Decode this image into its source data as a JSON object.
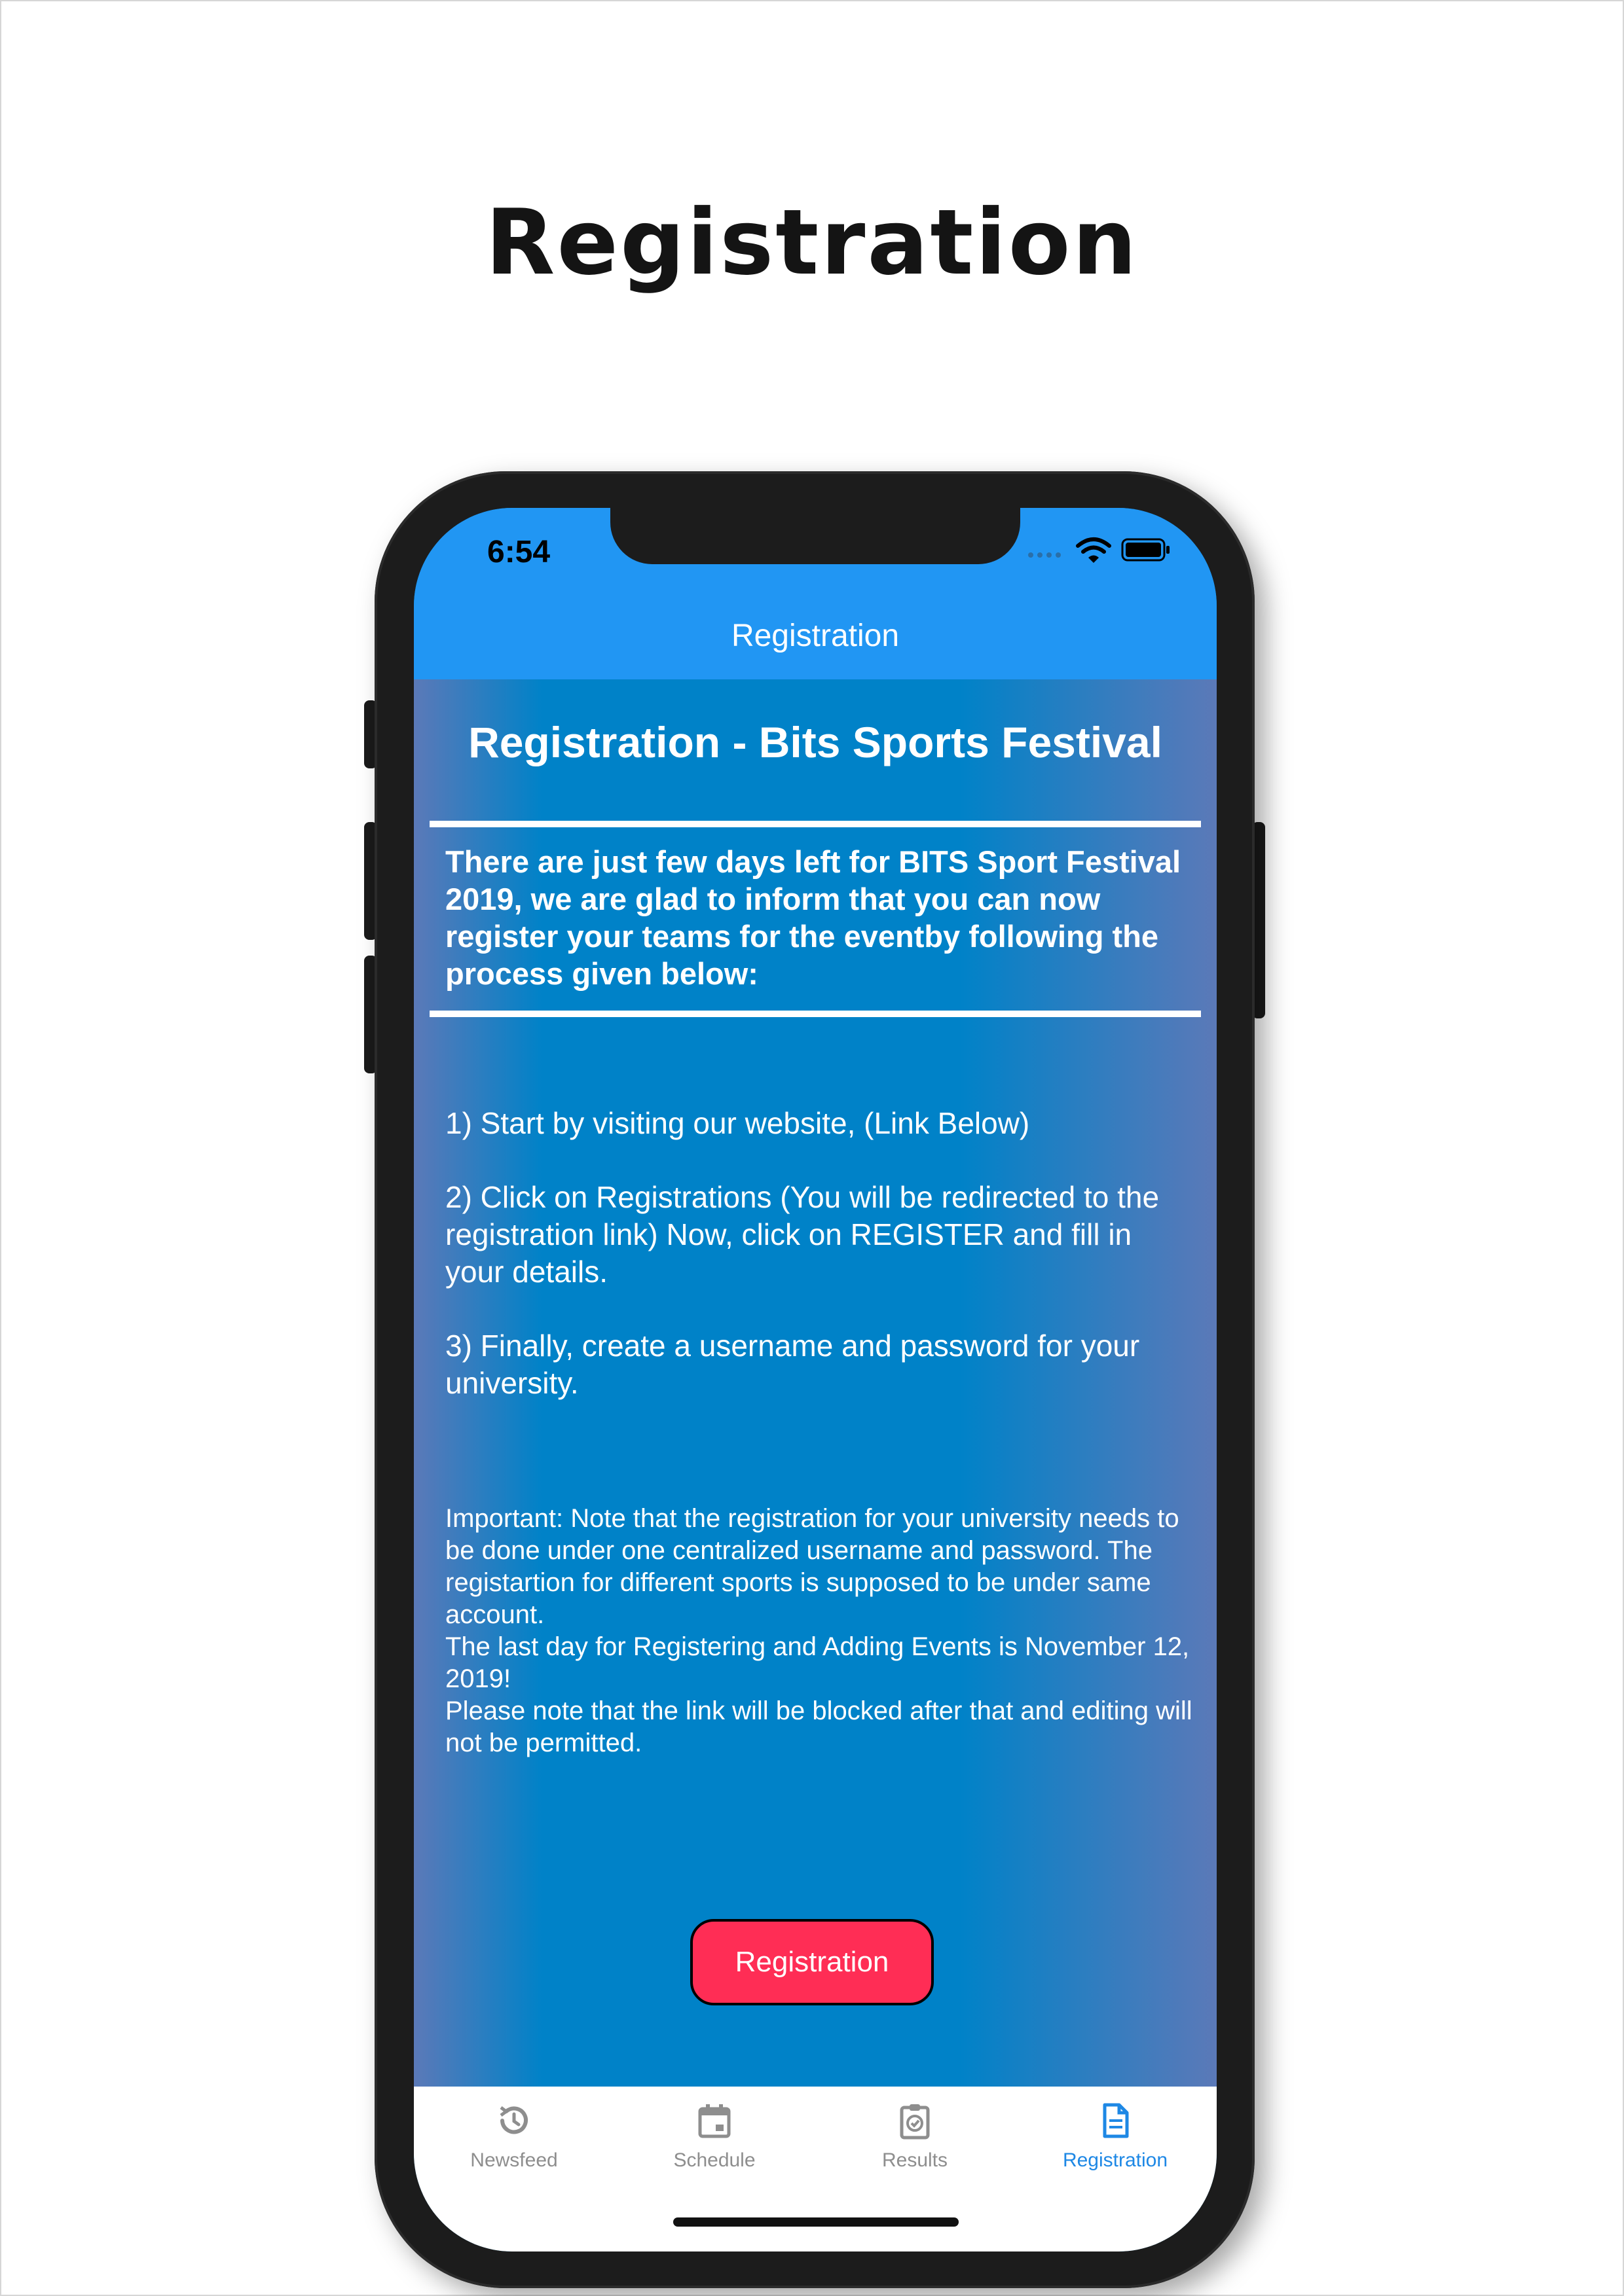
{
  "promo": {
    "title": "Registration"
  },
  "status_bar": {
    "time": "6:54"
  },
  "nav": {
    "title": "Registration"
  },
  "content": {
    "headline": "Registration - Bits Sports Festival",
    "intro": "There are just few days left for BITS Sport Festival 2019, we are glad to inform that you can now register your teams for the eventby following the process given below:",
    "steps": [
      "1) Start by visiting our website, (Link Below)",
      "2) Click on Registrations (You will be redirected to the registration link) Now, click on REGISTER and fill in your details.",
      "3) Finally, create a username and password for your university."
    ],
    "important": "Important: Note that the registration for your university needs to be done under one centralized username and password. The registartion for different sports is supposed to be under same account.\n The last day for Registering and Adding Events is November 12, 2019!\n Please note that the link will be blocked after that and editing will not be permitted.",
    "button_label": "Registration"
  },
  "tabs": [
    {
      "label": "Newsfeed",
      "icon": "history-icon",
      "active": false
    },
    {
      "label": "Schedule",
      "icon": "calendar-icon",
      "active": false
    },
    {
      "label": "Results",
      "icon": "clipboard-check-icon",
      "active": false
    },
    {
      "label": "Registration",
      "icon": "document-icon",
      "active": true
    }
  ],
  "colors": {
    "nav_bar": "#2196f3",
    "content_bg": "#0082c8",
    "button": "#ff2d55",
    "active_tab": "#1e88e5",
    "inactive_tab": "#8e8e8e"
  }
}
